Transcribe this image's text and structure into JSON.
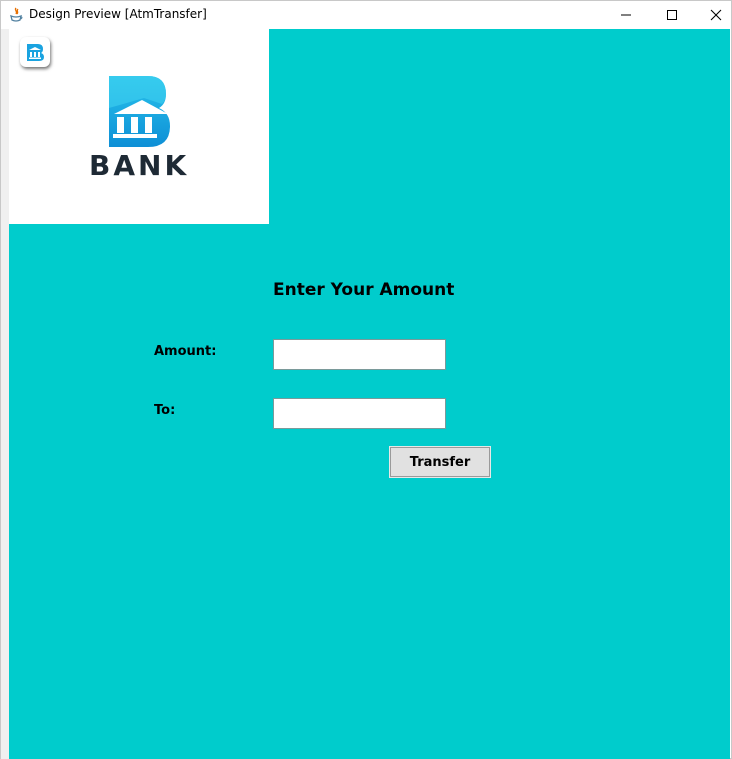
{
  "window": {
    "title": "Design Preview [AtmTransfer]",
    "icon": "java-icon"
  },
  "logo": {
    "wordmark": "BANK",
    "icon": "bank-building-icon",
    "brand_color": "#1aa3e0",
    "text_color": "#1e2a35"
  },
  "form": {
    "heading": "Enter Your Amount",
    "amount_label": "Amount:",
    "amount_value": "",
    "to_label": "To:",
    "to_value": "",
    "submit_label": "Transfer"
  },
  "colors": {
    "background": "#00cccc",
    "panel": "#ffffff",
    "button": "#e1e1e1"
  }
}
